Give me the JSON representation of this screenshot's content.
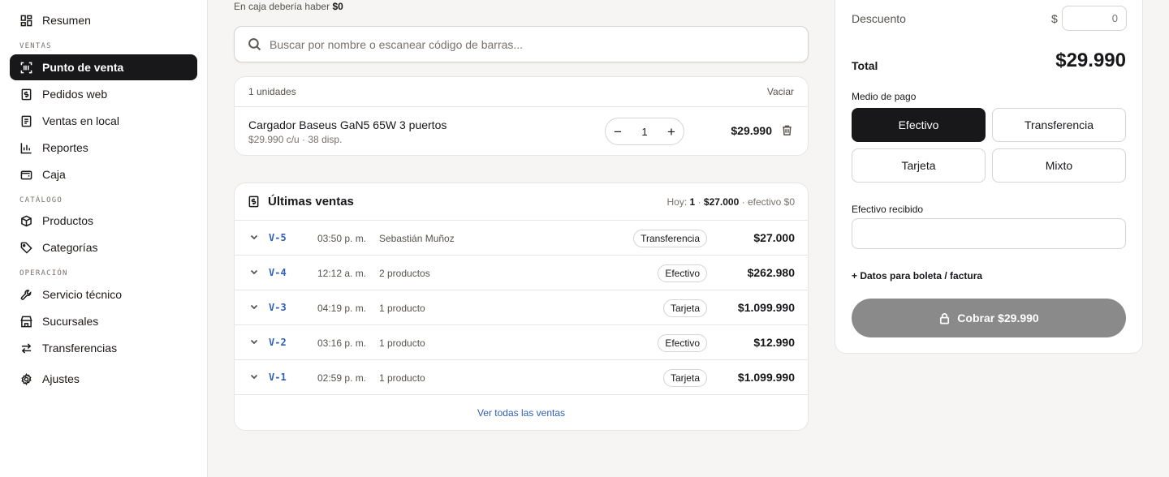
{
  "sidebar": {
    "top_item": {
      "label": "Resumen",
      "icon": "dashboard-icon"
    },
    "sections": [
      {
        "label": "VENTAS",
        "items": [
          {
            "label": "Punto de venta",
            "icon": "barcode-scan-icon",
            "active": true
          },
          {
            "label": "Pedidos web",
            "icon": "receipt-dollar-icon"
          },
          {
            "label": "Ventas en local",
            "icon": "document-icon"
          },
          {
            "label": "Reportes",
            "icon": "bar-chart-icon"
          },
          {
            "label": "Caja",
            "icon": "wallet-icon"
          }
        ]
      },
      {
        "label": "CATÁLOGO",
        "items": [
          {
            "label": "Productos",
            "icon": "box-icon"
          },
          {
            "label": "Categorías",
            "icon": "tag-icon"
          }
        ]
      },
      {
        "label": "OPERACIÓN",
        "items": [
          {
            "label": "Servicio técnico",
            "icon": "wrench-icon"
          },
          {
            "label": "Sucursales",
            "icon": "store-icon"
          },
          {
            "label": "Transferencias",
            "icon": "arrows-swap-icon"
          }
        ]
      }
    ],
    "settings": {
      "label": "Ajustes",
      "icon": "gear-icon"
    }
  },
  "cash_note": {
    "prefix": "En caja debería haber",
    "amount": "$0"
  },
  "search": {
    "placeholder": "Buscar por nombre o escanear código de barras..."
  },
  "cart": {
    "units_label": "1 unidades",
    "clear_label": "Vaciar",
    "items": [
      {
        "name": "Cargador Baseus GaN5 65W 3 puertos",
        "sub": "$29.990 c/u · 38 disp.",
        "qty": "1",
        "total": "$29.990"
      }
    ]
  },
  "recent_sales": {
    "title": "Últimas ventas",
    "summary": {
      "today_label": "Hoy:",
      "count": "1",
      "sep": "·",
      "amount": "$27.000",
      "cash": "· efectivo $0"
    },
    "rows": [
      {
        "code": "V-5",
        "time": "03:50 p. m.",
        "desc": "Sebastián Muñoz",
        "method": "Transferencia",
        "amount": "$27.000"
      },
      {
        "code": "V-4",
        "time": "12:12 a. m.",
        "desc": "2 productos",
        "method": "Efectivo",
        "amount": "$262.980"
      },
      {
        "code": "V-3",
        "time": "04:19 p. m.",
        "desc": "1 producto",
        "method": "Tarjeta",
        "amount": "$1.099.990"
      },
      {
        "code": "V-2",
        "time": "03:16 p. m.",
        "desc": "1 producto",
        "method": "Efectivo",
        "amount": "$12.990"
      },
      {
        "code": "V-1",
        "time": "02:59 p. m.",
        "desc": "1 producto",
        "method": "Tarjeta",
        "amount": "$1.099.990"
      }
    ],
    "see_all": "Ver todas las ventas"
  },
  "checkout": {
    "discount_label": "Descuento",
    "currency": "$",
    "discount_placeholder": "0",
    "total_label": "Total",
    "total_value": "$29.990",
    "payment_label": "Medio de pago",
    "payment_methods": [
      {
        "label": "Efectivo",
        "active": true
      },
      {
        "label": "Transferencia"
      },
      {
        "label": "Tarjeta"
      },
      {
        "label": "Mixto"
      }
    ],
    "cash_received_label": "Efectivo recibido",
    "invoice_link": "+ Datos para boleta / factura",
    "charge_label": "Cobrar $29.990"
  },
  "colors": {
    "primary": "#18181b",
    "link": "#2f5fb8",
    "disabled": "#8a8a8a",
    "background": "#f6f5f3"
  }
}
